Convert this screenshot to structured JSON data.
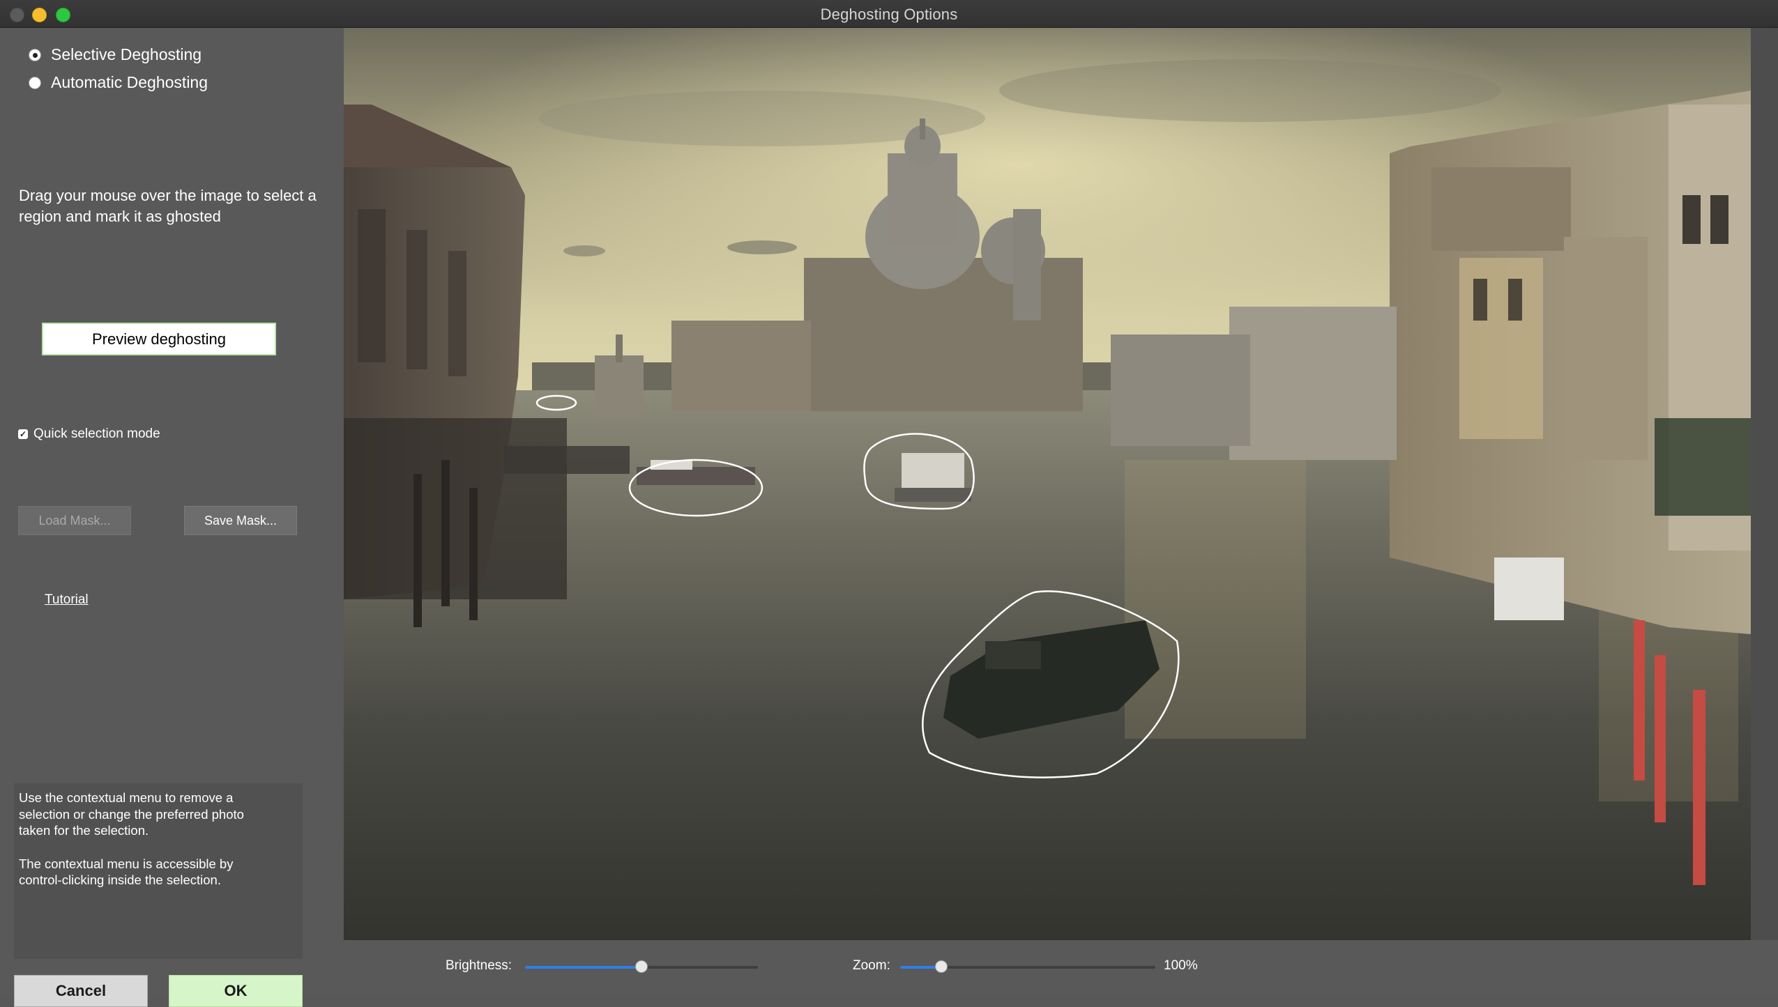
{
  "window": {
    "title": "Deghosting Options"
  },
  "mode": {
    "options": [
      {
        "label": "Selective Deghosting",
        "selected": true
      },
      {
        "label": "Automatic Deghosting",
        "selected": false
      }
    ]
  },
  "instructions": "Drag your mouse over the image to select a region and mark it as ghosted",
  "preview_button": "Preview deghosting",
  "quick_selection": {
    "label": "Quick selection mode",
    "checked": true
  },
  "mask": {
    "load_label": "Load Mask...",
    "load_enabled": false,
    "save_label": "Save Mask..."
  },
  "tutorial_link": "Tutorial",
  "help": {
    "paragraph1": "Use the contextual menu to remove a selection or change the preferred photo taken for the selection.",
    "paragraph2": "The contextual menu is accessible by control-clicking inside the selection."
  },
  "footer": {
    "cancel_label": "Cancel",
    "ok_label": "OK"
  },
  "brightness": {
    "label": "Brightness:",
    "level": 0.5
  },
  "zoom": {
    "label": "Zoom:",
    "value": "100%",
    "level": 0.16
  },
  "colors": {
    "accent": "#2f7fe6",
    "ok_button": "#d6f5c8",
    "selection_outline": "#ffffff"
  }
}
